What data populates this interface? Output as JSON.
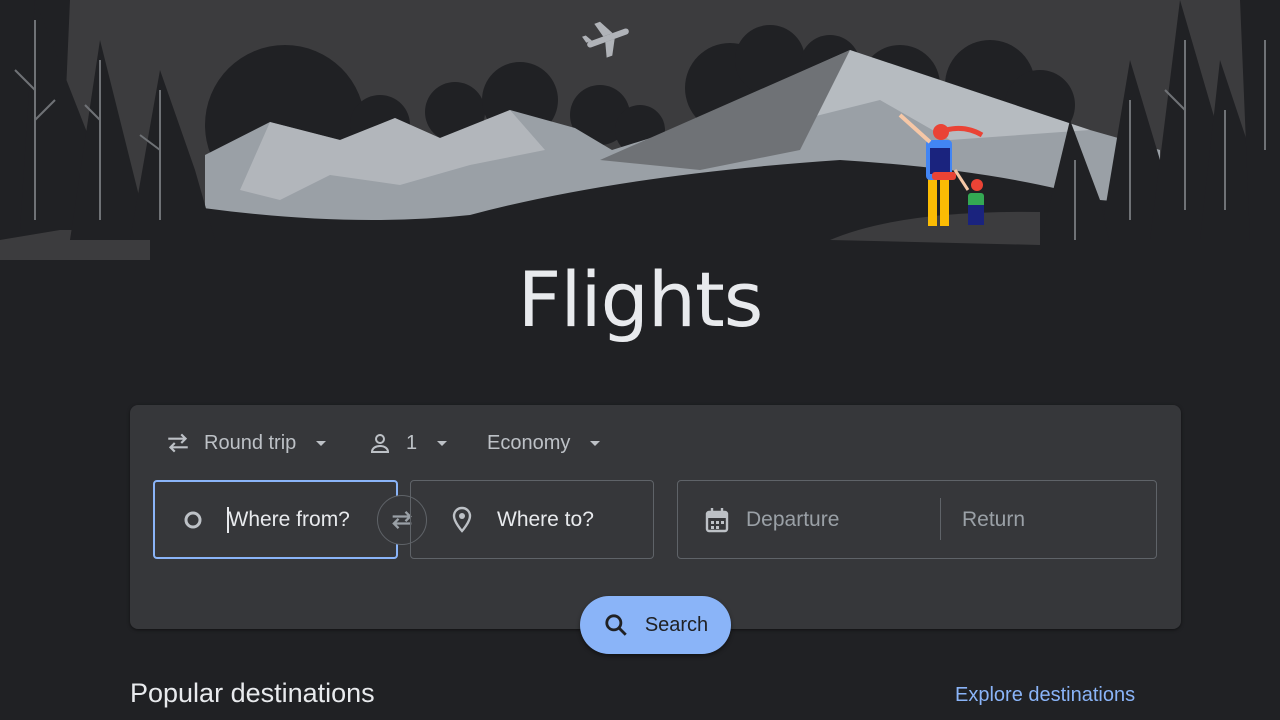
{
  "hero": {
    "title": "Flights"
  },
  "options": {
    "trip_type": "Round trip",
    "passengers": "1",
    "cabin_class": "Economy"
  },
  "fields": {
    "from_placeholder": "Where from?",
    "to_placeholder": "Where to?",
    "departure_placeholder": "Departure",
    "return_placeholder": "Return"
  },
  "search": {
    "label": "Search"
  },
  "popular": {
    "heading": "Popular destinations",
    "explore_link": "Explore destinations"
  },
  "colors": {
    "background": "#202124",
    "card": "#36373a",
    "accent": "#8ab4f8",
    "text": "#e8eaed",
    "muted_text": "#9aa0a6"
  },
  "icons": [
    "airplane-icon",
    "swap-icon",
    "person-icon",
    "dropdown-arrow-icon",
    "origin-circle-icon",
    "location-pin-icon",
    "calendar-icon",
    "search-icon"
  ]
}
